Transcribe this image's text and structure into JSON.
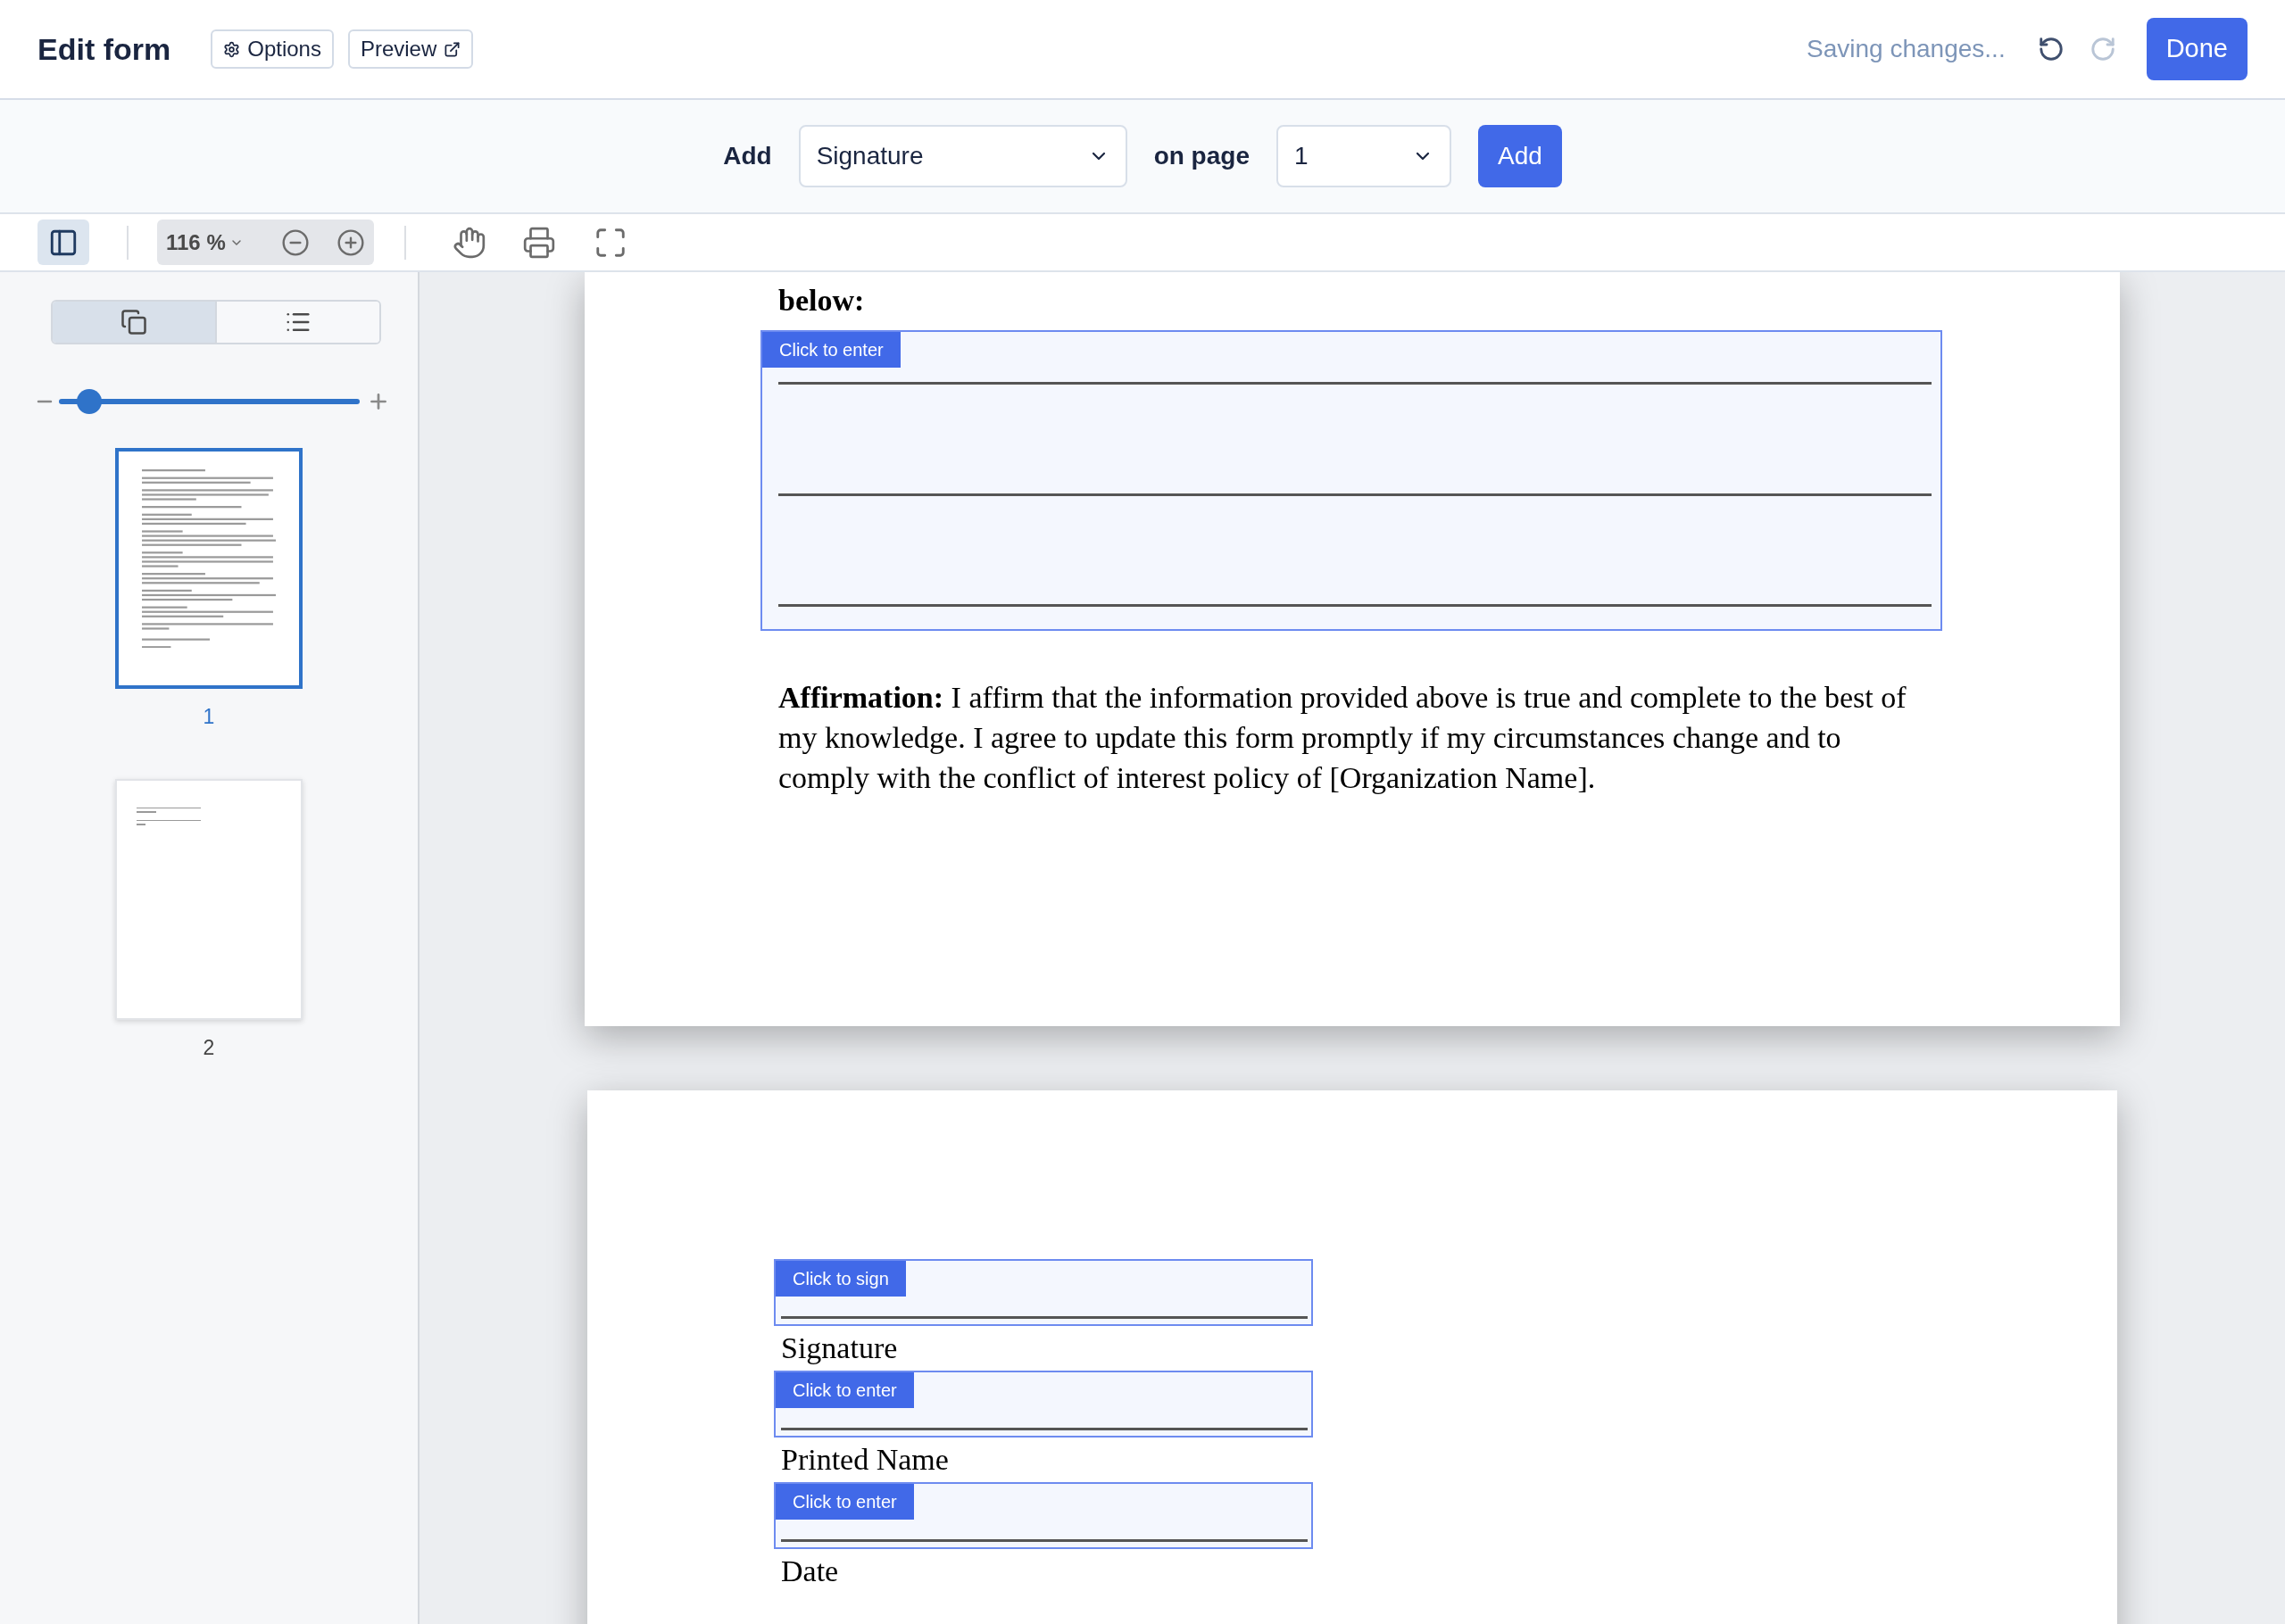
{
  "header": {
    "title": "Edit form",
    "buttons": [
      {
        "kind": "options",
        "label": "Options"
      },
      {
        "kind": "preview",
        "label": "Preview"
      }
    ],
    "status": "Saving changes...",
    "undo": {
      "disabled": false
    },
    "redo": {
      "disabled": true
    },
    "done_button": "Done"
  },
  "add_bar": {
    "label": "Add",
    "field_type": "Signature",
    "page_label": "on page",
    "page": "1",
    "button": "Add"
  },
  "toolbar": {
    "sidebar_toggle": {
      "on": true
    },
    "zoom": "116 %"
  },
  "sidebar": {
    "views": [
      {
        "kind": "thumbnails",
        "selected": true
      },
      {
        "kind": "outline",
        "selected": false
      }
    ],
    "thumbnail_size": {
      "level": 0.1
    },
    "pages": [
      {
        "kind": "text",
        "label": "1",
        "selected": true
      },
      {
        "kind": "signature",
        "label": "2",
        "selected": false
      }
    ]
  },
  "document": {
    "pages": [
      {
        "blocks": [
          {
            "kind": "heading",
            "text": "below:"
          },
          {
            "kind": "multiline_field",
            "tab": "Click to enter"
          },
          {
            "kind": "paragraph",
            "text": "**Affirmation:** I affirm that the information provided above is true and complete to the best of my knowledge. I agree to update this form promptly if my circumstances change and to comply with the conflict of interest policy of [Organization Name]."
          }
        ]
      },
      {
        "blocks": [
          {
            "kind": "field",
            "tab": "Click to sign",
            "caption": "Signature"
          },
          {
            "kind": "field",
            "tab": "Click to enter",
            "caption": "Printed Name"
          },
          {
            "kind": "field",
            "tab": "Click to enter",
            "caption": "Date"
          }
        ]
      }
    ]
  }
}
